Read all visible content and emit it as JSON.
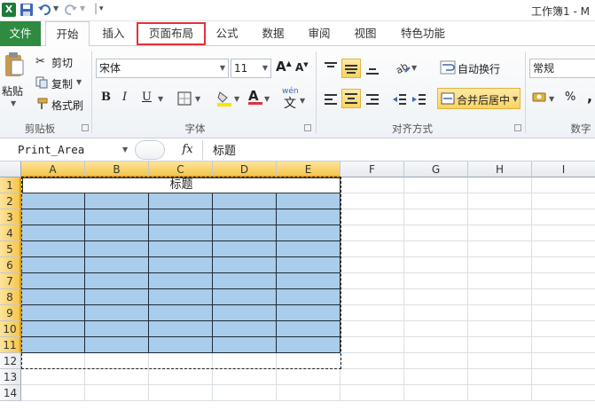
{
  "window": {
    "title": "工作簿1 - M"
  },
  "quick_access": {
    "icons": [
      "excel-icon",
      "save-icon",
      "undo-icon",
      "redo-icon",
      "customize-icon"
    ]
  },
  "tabs": [
    {
      "label": "文件"
    },
    {
      "label": "开始"
    },
    {
      "label": "插入"
    },
    {
      "label": "页面布局"
    },
    {
      "label": "公式"
    },
    {
      "label": "数据"
    },
    {
      "label": "审阅"
    },
    {
      "label": "视图"
    },
    {
      "label": "特色功能"
    }
  ],
  "ribbon": {
    "clipboard": {
      "label": "剪贴板",
      "paste": "粘贴",
      "cut": "剪切",
      "copy": "复制",
      "format_painter": "格式刷"
    },
    "font": {
      "label": "字体",
      "font_name": "宋体",
      "font_size": "11",
      "bold": "B",
      "italic": "I",
      "underline": "U",
      "increase": "A",
      "decrease": "A",
      "font_color_glyph": "A",
      "phonetic": "wén"
    },
    "alignment": {
      "label": "对齐方式",
      "wrap_text": "自动换行",
      "merge_center": "合并后居中"
    },
    "number": {
      "label": "数字",
      "format": "常规",
      "percent": "%",
      "comma": ","
    }
  },
  "formula_bar": {
    "name_box": "Print_Area",
    "fx": "fx",
    "content": "标题"
  },
  "grid": {
    "columns": [
      "A",
      "B",
      "C",
      "D",
      "E",
      "F",
      "G",
      "H",
      "I"
    ],
    "rows": [
      "1",
      "2",
      "3",
      "4",
      "5",
      "6",
      "7",
      "8",
      "9",
      "10",
      "11",
      "12",
      "13",
      "14"
    ],
    "title_cell": "标题"
  },
  "colors": {
    "accent_file": "#2e8b3f",
    "highlight": "#e5303a",
    "selection_fill": "#a9cdea"
  }
}
